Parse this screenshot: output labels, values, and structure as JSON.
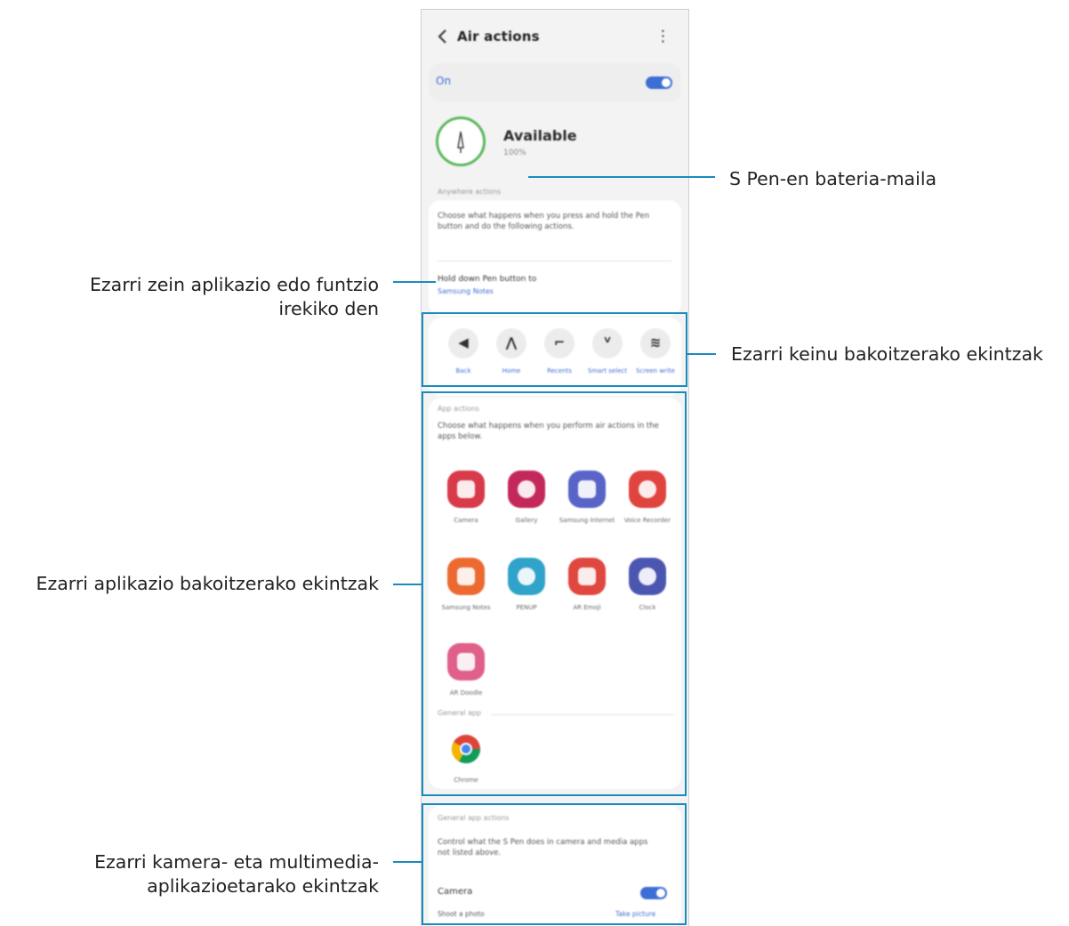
{
  "phone": {
    "title": "Air actions",
    "more_glyph": "⋮",
    "main_switch_label": "On",
    "status_title": "Available",
    "battery_text": "100%",
    "shortcut_section_label": "Anywhere actions",
    "shortcut_desc": "Choose what happens when you press and hold the Pen button and do the following actions.",
    "hold_down_label": "Hold down Pen button to",
    "hold_down_value": "Samsung Notes",
    "gestures": [
      {
        "glyph": "◀",
        "name": "Back"
      },
      {
        "glyph": "⋀",
        "name": "Home"
      },
      {
        "glyph": "⌐",
        "name": "Recents"
      },
      {
        "glyph": "ⱽ",
        "name": "Smart select"
      },
      {
        "glyph": "≋",
        "name": "Screen write"
      }
    ],
    "app_section_label": "App actions",
    "app_desc": "Choose what happens when you perform air actions in the apps below.",
    "apps": [
      {
        "name": "Camera",
        "color": "#d83a4a",
        "icon": "camera-icon"
      },
      {
        "name": "Gallery",
        "color": "#c4285a",
        "icon": "gallery-icon"
      },
      {
        "name": "Samsung Internet",
        "color": "#5a63c8",
        "icon": "internet-icon"
      },
      {
        "name": "Voice Recorder",
        "color": "#e0443e",
        "icon": "recorder-icon"
      },
      {
        "name": "Samsung Notes",
        "color": "#ec6a30",
        "icon": "notes-icon"
      },
      {
        "name": "PENUP",
        "color": "#2fa3c9",
        "icon": "penup-icon"
      },
      {
        "name": "AR Emoji",
        "color": "#e0473f",
        "icon": "ar-emoji-icon"
      },
      {
        "name": "Clock",
        "color": "#4b56b0",
        "icon": "clock-icon"
      },
      {
        "name": "AR Doodle",
        "color": "#e0608a",
        "icon": "ar-doodle-icon"
      }
    ],
    "general_section_label": "General app",
    "general_apps": [
      {
        "name": "Chrome",
        "icon": "chrome-icon"
      }
    ],
    "media_section_label": "General app actions",
    "media_desc": "Control what the S Pen does in camera and media apps not listed above.",
    "media_setting_name": "Camera",
    "media_row_left": "Shoot a photo",
    "media_row_right": "Take picture"
  },
  "callouts": {
    "battery": "S Pen-en bateria-maila",
    "hold_down": [
      "Ezarri zein aplikazio edo funtzio",
      "irekiko den"
    ],
    "gestures": "Ezarri keinu bakoitzerako ekintzak",
    "apps": "Ezarri aplikazio bakoitzerako ekintzak",
    "media": [
      "Ezarri kamera- eta multimedia-",
      "aplikazioetarako ekintzak"
    ]
  },
  "colors": {
    "accent": "#3d6ed6",
    "callout_line": "#1a8bbf"
  }
}
